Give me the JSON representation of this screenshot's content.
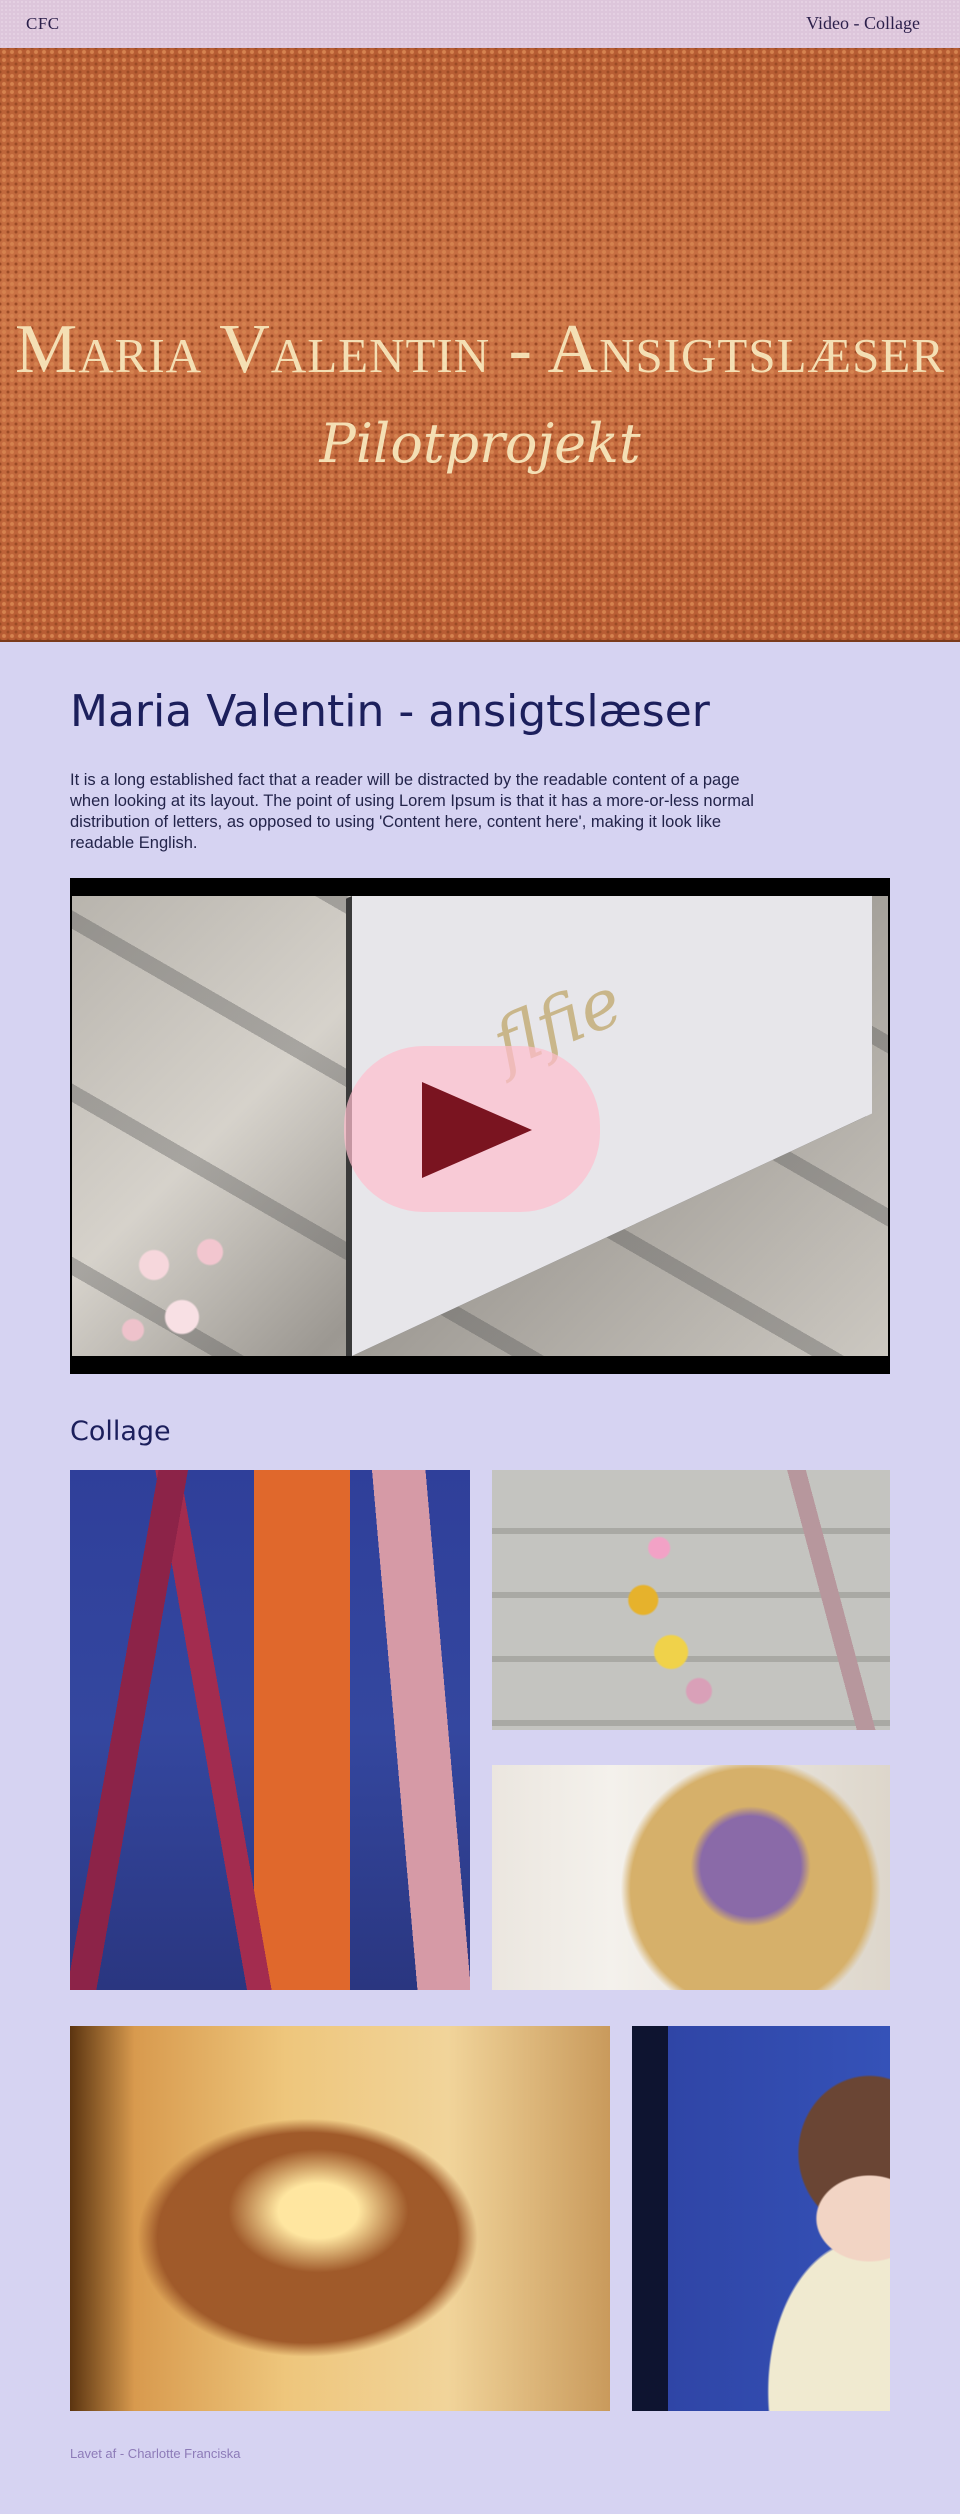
{
  "topbar": {
    "logo": "CFC",
    "nav": [
      "Video",
      "Collage"
    ],
    "separator": " - "
  },
  "hero": {
    "title": "Maria Valentin - Ansigtslæser",
    "subtitle": "Pilotprojekt"
  },
  "main": {
    "title": "Maria Valentin - ansigtslæser",
    "intro": "It is a long established fact that a reader will be distracted by the readable content of a page when looking at its layout. The point of using Lorem Ipsum is that it has a more-or-less normal distribution of letters, as opposed to using 'Content here, content here', making it look like readable English."
  },
  "video": {
    "sign_text": "flfie",
    "play_icon": "play-icon"
  },
  "collage": {
    "title": "Collage",
    "images": [
      "pampas-grass",
      "flowers-ladder",
      "paper-flower",
      "woven-lamp",
      "portrait"
    ]
  },
  "footer": {
    "credit": "Lavet af - Charlotte Franciska"
  },
  "colors": {
    "background": "#d6d3f2",
    "topbar": "#ddc6db",
    "hero": "#c26a3e",
    "hero_text": "#f4dfb4",
    "heading": "#1c1f5c",
    "play_button": "#7a1420"
  }
}
